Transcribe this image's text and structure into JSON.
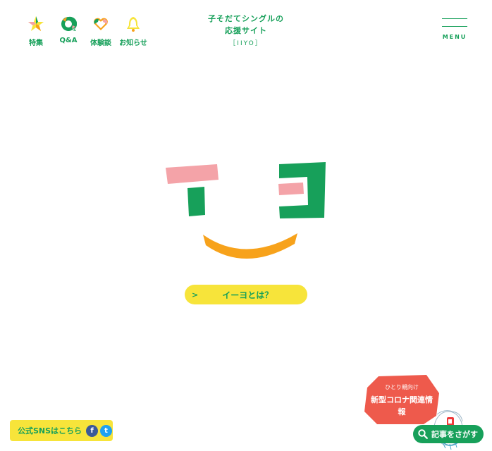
{
  "nav": {
    "items": [
      {
        "label": "特集",
        "icon": "star-icon"
      },
      {
        "label": "Q&A",
        "icon": "qa-icon"
      },
      {
        "label": "体験談",
        "icon": "heart-icon"
      },
      {
        "label": "お知らせ",
        "icon": "bell-icon"
      }
    ]
  },
  "header": {
    "title_line1": "子そだてシングルの",
    "title_line2": "応援サイト",
    "subtitle": "［IIYO］"
  },
  "menu": {
    "label": "MENU"
  },
  "about": {
    "chevron": ">",
    "label": "イーヨとは？"
  },
  "corona": {
    "top": "ひとり親向け",
    "main": "新型コロナ関連情報"
  },
  "sns": {
    "label": "公式SNSはこちら",
    "facebook": "f",
    "twitter": "t"
  },
  "search": {
    "label": "記事をさがす"
  },
  "colors": {
    "green": "#17a05a",
    "yellow": "#f7e43a",
    "pink": "#f4a3a8",
    "orange": "#f7a21b",
    "red": "#ee5a4c"
  }
}
